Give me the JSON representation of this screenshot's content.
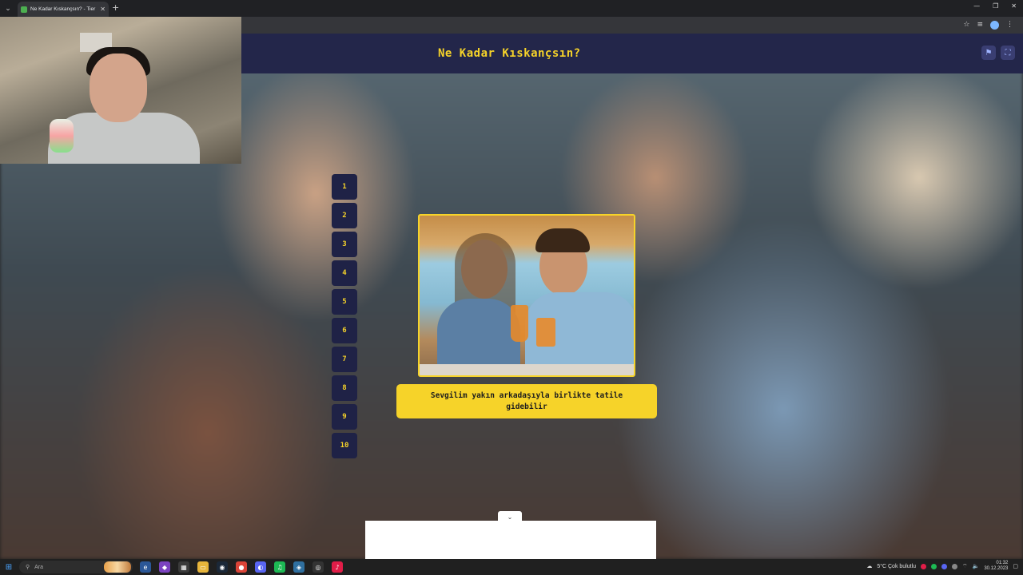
{
  "browser": {
    "tab_title": "Ne Kadar Kıskançsın? - Tier List",
    "tab_close": "✕",
    "new_tab": "+",
    "window_controls": [
      "—",
      "❐",
      "✕"
    ]
  },
  "site": {
    "title": "Ne Kadar Kıskançsın?",
    "flag_icon": "flag-icon",
    "fullscreen_icon": "fullscreen-icon"
  },
  "levels": [
    "1",
    "2",
    "3",
    "4",
    "5",
    "6",
    "7",
    "8",
    "9",
    "10"
  ],
  "card": {
    "image_alt": "couple-with-drinks-photo",
    "text": "Sevgilim yakın arkadaşıyla birlikte tatile gidebilir"
  },
  "ad": {
    "toggle_icon": "chevron-down-icon"
  },
  "taskbar": {
    "search_label": "Ara",
    "weather": "5°C  Çok bulutlu",
    "time": "01:32",
    "date": "30.12.2023"
  },
  "colors": {
    "accent": "#f6d329",
    "header_bg": "#23264a",
    "level_bg": "#1f2246"
  }
}
